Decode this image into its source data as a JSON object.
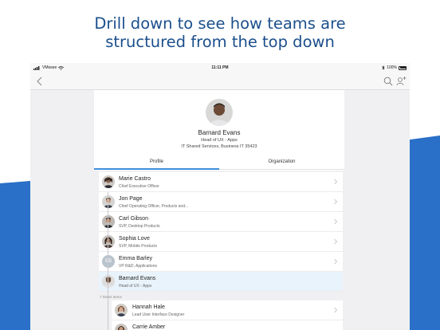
{
  "headline": {
    "line1": "Drill down to see how teams are",
    "line2": "structured from the top down"
  },
  "status_bar": {
    "carrier": "VMware",
    "time": "11:11 PM",
    "battery": "100%"
  },
  "navbar": {
    "back_icon": "chevron-left-icon",
    "search_icon": "search-icon",
    "add_user_icon": "add-user-icon"
  },
  "profile": {
    "name": "Barnard Evans",
    "role": "Head of UX - Apps",
    "org": "IT Shared Services, Business IT 35423"
  },
  "tabs": [
    {
      "label": "Profile",
      "selected": true
    },
    {
      "label": "Organization",
      "selected": false
    }
  ],
  "hierarchy": [
    {
      "name": "Marie Castro",
      "title": "Chief Executive Officer"
    },
    {
      "name": "Jon Page",
      "title": "Chief Operating Officer, Products and..."
    },
    {
      "name": "Carl Gibson",
      "title": "SVP, Desktop Products"
    },
    {
      "name": "Sophia Love",
      "title": "SVP, Mobile Products"
    },
    {
      "name": "Emma Barley",
      "title": "VP R&D, Applications",
      "initials": "EB"
    },
    {
      "name": "Barnard Evans",
      "title": "Head of UX - Apps"
    }
  ],
  "reports_label": "7 Direct Items",
  "direct_reports": [
    {
      "name": "Hannah Hale",
      "title": "Lead User Interface Designer"
    },
    {
      "name": "Carrie Amber",
      "title": ""
    }
  ],
  "colors": {
    "headline": "#1b4f8c",
    "wave": "#2a70c8",
    "accent": "#3d8fd9",
    "active_row": "#e9f3fb"
  }
}
